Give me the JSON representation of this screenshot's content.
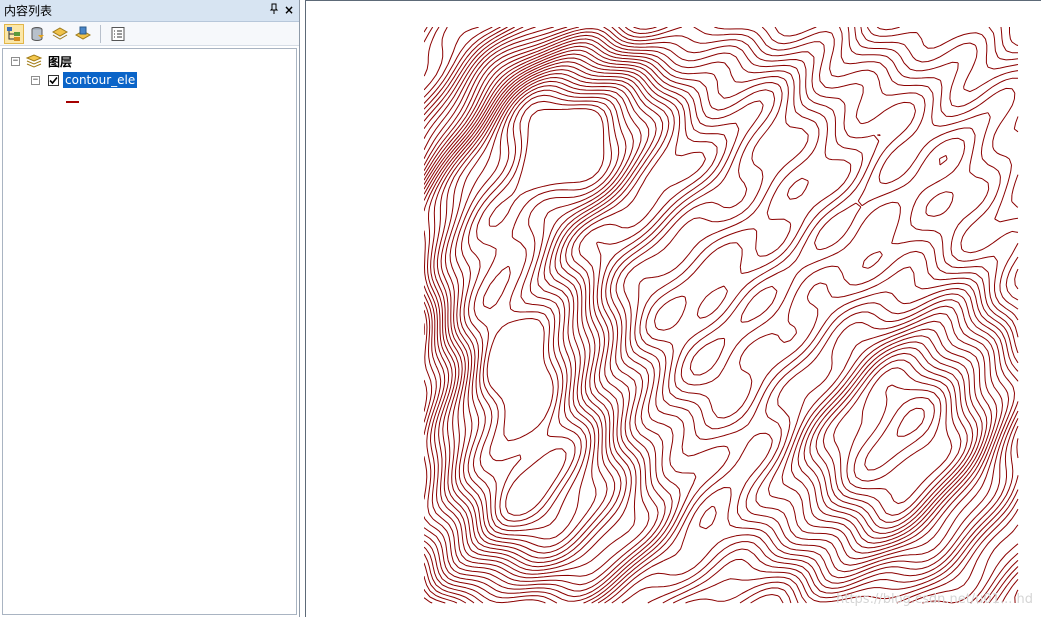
{
  "toc": {
    "title": "内容列表",
    "pin_icon": "pin-icon",
    "close_label": "×",
    "toolbar": [
      {
        "name": "list-by-drawing-order-button",
        "icon": "layers-tree-icon",
        "active": true
      },
      {
        "name": "list-by-source-button",
        "icon": "database-icon",
        "active": false
      },
      {
        "name": "list-by-visibility-button",
        "icon": "layer-stack-icon",
        "active": false
      },
      {
        "name": "list-by-selection-button",
        "icon": "selection-layer-icon",
        "active": false
      },
      {
        "name": "options-button",
        "icon": "options-list-icon",
        "active": false
      }
    ],
    "group": {
      "label": "图层",
      "expander": "−"
    },
    "layer": {
      "label": "contour_ele",
      "checked": true,
      "expander": "−",
      "symbol_color": "#a50000"
    }
  },
  "map": {
    "layer_color": "#8b0000",
    "background": "#ffffff",
    "watermark": "https://blog.csdn.net/u01... hd"
  }
}
